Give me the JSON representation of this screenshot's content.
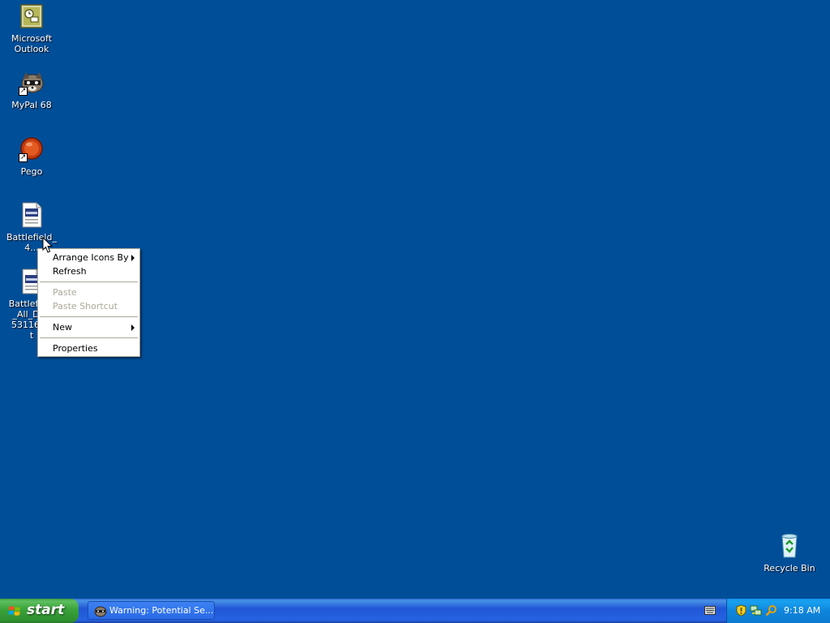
{
  "desktop": {
    "background_color": "#004e98",
    "icons": [
      {
        "label": "Microsoft\nOutlook",
        "icon": "outlook-icon"
      },
      {
        "label": "MyPal 68",
        "icon": "mypal-icon"
      },
      {
        "label": "Pego",
        "icon": "pego-icon"
      },
      {
        "label": "Battlefield_4...",
        "icon": "text-file-icon"
      },
      {
        "label": "Battlefield\n_All_DLC\n531162.r\nt",
        "icon": "text-file-icon"
      },
      {
        "label": "Recycle Bin",
        "icon": "recycle-bin-icon"
      }
    ]
  },
  "context_menu": {
    "items": [
      {
        "label": "Arrange Icons By",
        "submenu": true,
        "enabled": true
      },
      {
        "label": "Refresh",
        "submenu": false,
        "enabled": true
      },
      {
        "label": "Paste",
        "submenu": false,
        "enabled": false
      },
      {
        "label": "Paste Shortcut",
        "submenu": false,
        "enabled": false
      },
      {
        "label": "New",
        "submenu": true,
        "enabled": true
      },
      {
        "label": "Properties",
        "submenu": false,
        "enabled": true
      }
    ]
  },
  "taskbar": {
    "start_label": "start",
    "task_button_label": "Warning: Potential Se...",
    "tray_icons": [
      "keyboard-icon",
      "security-shield-icon",
      "network-icon",
      "search-icon"
    ],
    "clock": "9:18 AM"
  }
}
